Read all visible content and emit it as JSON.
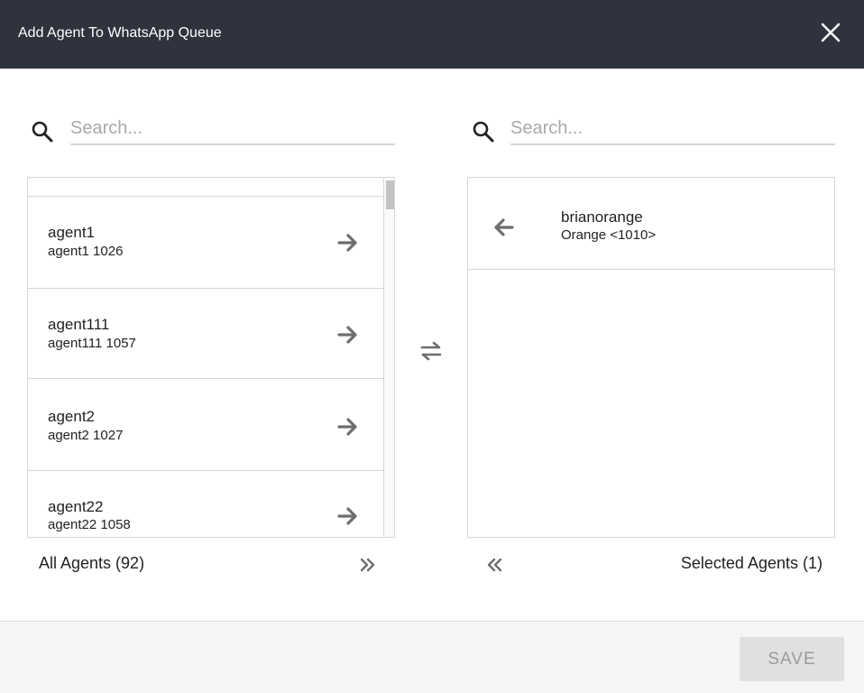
{
  "dialog": {
    "title": "Add Agent To WhatsApp Queue",
    "header_bg": "#2e333e"
  },
  "left": {
    "search_placeholder": "Search...",
    "agents": [
      {
        "name": "agent1",
        "sub": "agent1 1026"
      },
      {
        "name": "agent111",
        "sub": "agent111 1057"
      },
      {
        "name": "agent2",
        "sub": "agent2 1027"
      },
      {
        "name": "agent22",
        "sub": "agent22 1058"
      }
    ],
    "count_label": "All Agents (92)"
  },
  "right": {
    "search_placeholder": "Search...",
    "selected": [
      {
        "name": "brianorange",
        "sub": "Orange <1010>"
      }
    ],
    "count_label": "Selected Agents (1)"
  },
  "icons": {
    "close": "close-icon",
    "search": "search-icon",
    "add": "arrow-right-icon",
    "remove": "arrow-left-icon",
    "swap": "swap-icon",
    "add_all": "double-chevron-right-icon",
    "remove_all": "double-chevron-left-icon"
  },
  "footer": {
    "save_label": "SAVE"
  }
}
